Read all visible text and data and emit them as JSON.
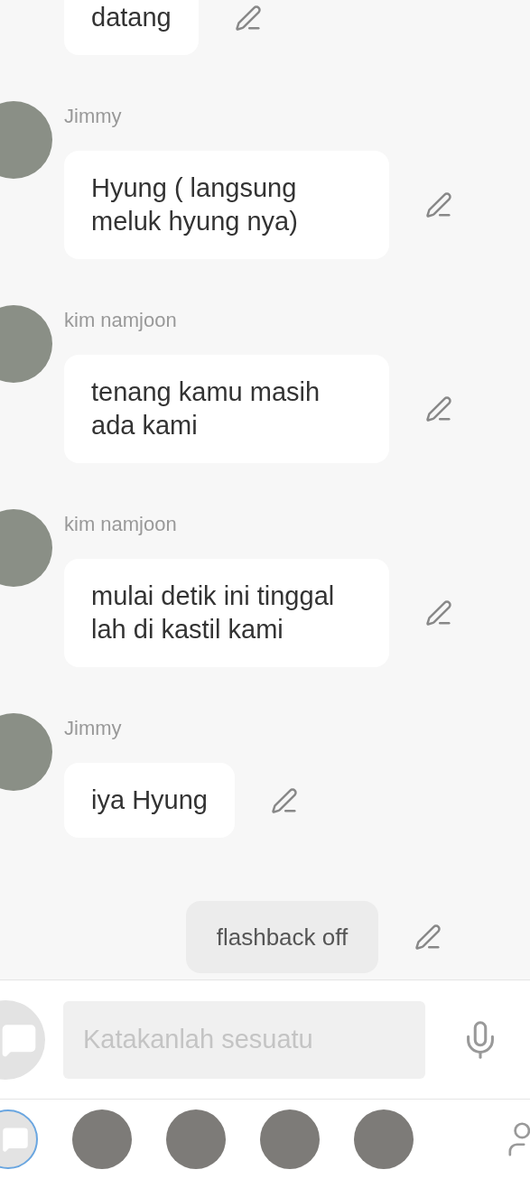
{
  "messages": [
    {
      "kind": "chat",
      "text": "datang"
    },
    {
      "kind": "chat",
      "sender": "Jimmy",
      "text": "Hyung ( langsung meluk hyung nya)"
    },
    {
      "kind": "chat",
      "sender": "kim namjoon",
      "text": "tenang kamu masih ada kami"
    },
    {
      "kind": "chat",
      "sender": "kim namjoon",
      "text": "mulai detik ini tinggal lah di kastil kami"
    },
    {
      "kind": "chat",
      "sender": "Jimmy",
      "text": "iya Hyung"
    },
    {
      "kind": "narration",
      "text": "flashback off"
    }
  ],
  "input": {
    "placeholder": "Katakanlah sesuatu"
  },
  "characters": [
    {
      "kind": "chat-switch",
      "selected": true
    },
    {
      "kind": "avatar",
      "selected": false
    },
    {
      "kind": "avatar",
      "selected": false
    },
    {
      "kind": "avatar",
      "selected": false
    },
    {
      "kind": "avatar",
      "selected": false
    }
  ]
}
